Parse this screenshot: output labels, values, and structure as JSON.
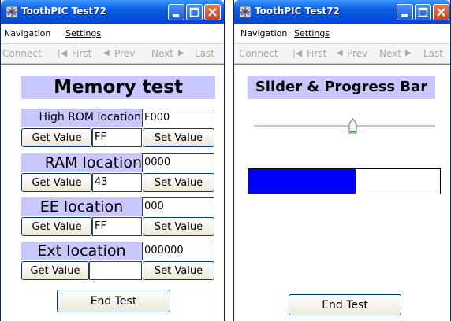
{
  "left_window": {
    "title": "ToothPIC Test72",
    "menu": [
      "Navigation",
      "Settings"
    ],
    "toolbar": {
      "connect": "Connect",
      "first": "First",
      "prev": "Prev",
      "next": "Next",
      "last": "Last"
    },
    "heading": "Memory test",
    "rows": [
      {
        "label": "High ROM location",
        "address": "F000",
        "get_label": "Get Value",
        "value": "FF",
        "set_label": "Set Value"
      },
      {
        "label": "RAM location",
        "address": "0000",
        "get_label": "Get Value",
        "value": "43",
        "set_label": "Set Value"
      },
      {
        "label": "EE location",
        "address": "000",
        "get_label": "Get Value",
        "value": "FF",
        "set_label": "Set Value"
      },
      {
        "label": "Ext location",
        "address": "000000",
        "get_label": "Get Value",
        "value": "",
        "set_label": "Set Value"
      }
    ],
    "end_button": "End Test"
  },
  "right_window": {
    "title": "ToothPIC Test72",
    "menu": [
      "Navigation",
      "Settings"
    ],
    "toolbar": {
      "connect": "Connect",
      "first": "First",
      "prev": "Prev",
      "next": "Next",
      "last": "Last"
    },
    "heading": "Silder & Progress Bar",
    "slider_value": 0.55,
    "progress_value": 0.56,
    "end_button": "End Test"
  },
  "colors": {
    "heading_bg": "#c8c8ff",
    "progress_fill": "#0000ff",
    "titlebar": "#0a5fe4"
  },
  "icons": {
    "app": "app-icon",
    "minimize": "minimize-icon",
    "maximize": "maximize-icon",
    "close": "close-icon"
  }
}
